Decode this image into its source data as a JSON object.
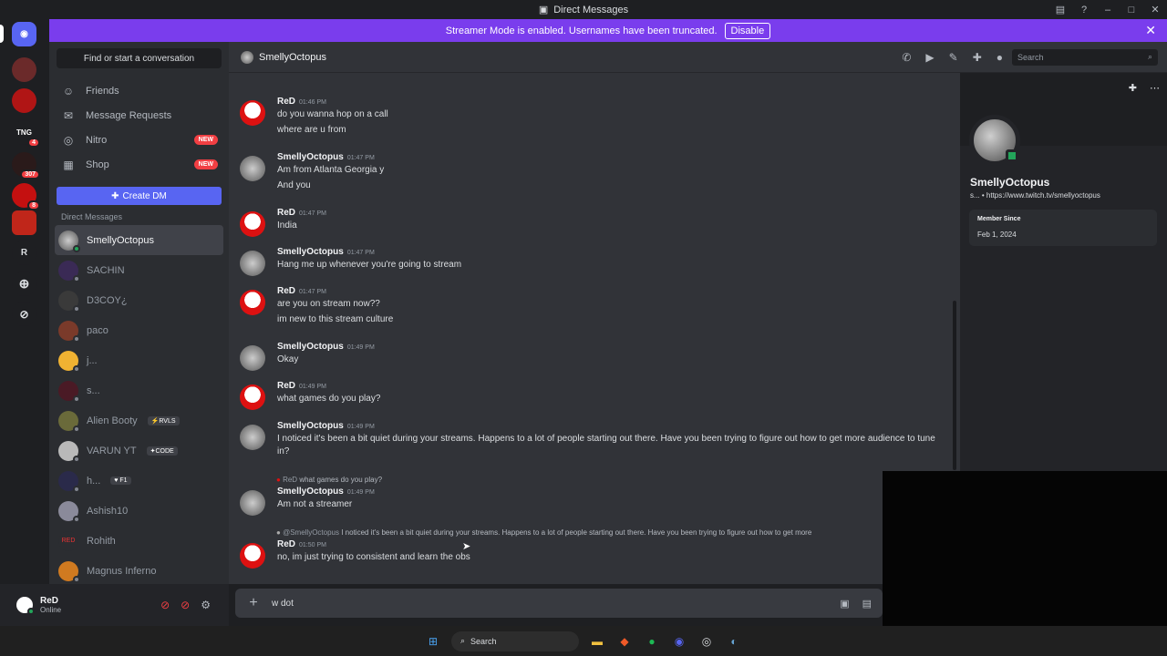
{
  "window": {
    "title": "Direct Messages"
  },
  "banner": {
    "text": "Streamer Mode is enabled. Usernames have been truncated.",
    "disable_label": "Disable"
  },
  "guild_badges": [
    "4",
    "307",
    "8"
  ],
  "guild_letter": "R",
  "sidebar": {
    "find_label": "Find or start a conversation",
    "nav": [
      {
        "label": "Friends"
      },
      {
        "label": "Message Requests"
      },
      {
        "label": "Nitro",
        "badge": "NEW"
      },
      {
        "label": "Shop",
        "badge": "NEW"
      }
    ],
    "create_dm_label": "Create DM",
    "dm_header": "Direct Messages",
    "dms": [
      {
        "name": "SmellyOctopus",
        "tag": ""
      },
      {
        "name": "SACHIN",
        "tag": ""
      },
      {
        "name": "D3COY¿",
        "tag": ""
      },
      {
        "name": "paco",
        "tag": ""
      },
      {
        "name": "j...",
        "tag": ""
      },
      {
        "name": "s...",
        "tag": ""
      },
      {
        "name": "Alien Booty",
        "tag": "⚡RVLS"
      },
      {
        "name": "VARUN YT",
        "tag": "✦CODE"
      },
      {
        "name": "h...",
        "tag": "♥ F1"
      },
      {
        "name": "Ashish10",
        "tag": ""
      },
      {
        "name": "Rohith",
        "tag": ""
      },
      {
        "name": "Magnus Inferno",
        "tag": ""
      }
    ]
  },
  "user": {
    "name": "ReD",
    "status": "Online"
  },
  "chat": {
    "title": "SmellyOctopus",
    "search_placeholder": "Search",
    "messages": [
      {
        "author": "ReD",
        "time": "01:46 PM",
        "lines": [
          "do you wanna hop on a call",
          "where are u from"
        ]
      },
      {
        "author": "SmellyOctopus",
        "time": "01:47 PM",
        "lines": [
          "Am from Atlanta Georgia y",
          "And you"
        ]
      },
      {
        "author": "ReD",
        "time": "01:47 PM",
        "lines": [
          "India"
        ]
      },
      {
        "author": "SmellyOctopus",
        "time": "01:47 PM",
        "lines": [
          "Hang me up whenever you're going to stream"
        ]
      },
      {
        "author": "ReD",
        "time": "01:47 PM",
        "lines": [
          "are you on stream now??",
          "im new to this stream culture"
        ]
      },
      {
        "author": "SmellyOctopus",
        "time": "01:49 PM",
        "lines": [
          "Okay"
        ]
      },
      {
        "author": "ReD",
        "time": "01:49 PM",
        "lines": [
          "what games do you play?"
        ]
      },
      {
        "author": "SmellyOctopus",
        "time": "01:49 PM",
        "lines": [
          "I noticed it's been a bit quiet during your streams. Happens to a lot of people starting out there. Have you been trying to figure out how to get more audience to tune in?"
        ]
      },
      {
        "author": "SmellyOctopus",
        "time": "01:49 PM",
        "lines": [
          "Am not a streamer"
        ],
        "reply_to": "ReD",
        "reply_text": "what games do you play?"
      },
      {
        "author": "ReD",
        "time": "01:50 PM",
        "lines": [
          "no, im just trying to consistent and learn the obs"
        ],
        "reply_to": "@SmellyOctopus",
        "reply_text": "I noticed it's been a bit quiet during your streams. Happens to a lot of people starting out there. Have you been trying to figure out how to get more"
      }
    ],
    "composer_value": "w dot"
  },
  "profile": {
    "name": "SmellyOctopus",
    "links": "s... • https://www.twitch.tv/smellyoctopus",
    "member_since_label": "Member Since",
    "member_since": "Feb 1, 2024"
  },
  "taskbar": {
    "search_label": "Search"
  },
  "colors": {
    "accent": "#5865f2",
    "banner": "#7a3ded",
    "online": "#23a55a",
    "badge": "#f23f43"
  }
}
